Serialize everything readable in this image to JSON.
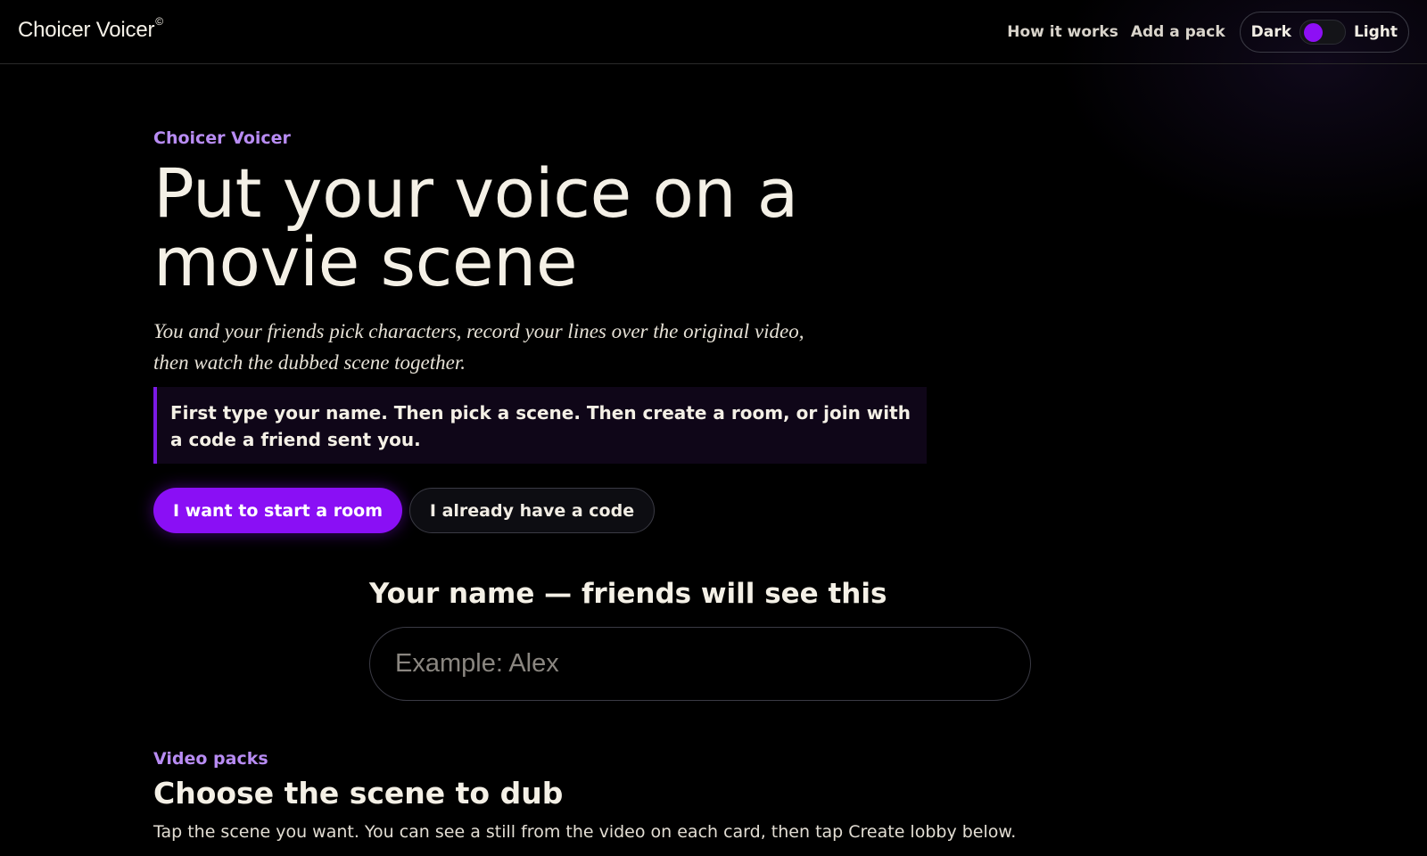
{
  "header": {
    "brand": "Choicer Voicer",
    "brand_mark": "©",
    "nav": {
      "how_it_works": "How it works",
      "add_pack": "Add a pack"
    },
    "theme": {
      "dark_label": "Dark",
      "light_label": "Light",
      "selected": "Dark"
    }
  },
  "hero": {
    "eyebrow": "Choicer Voicer",
    "title": "Put your voice on a movie scene",
    "subtitle": "You and your friends pick characters, record your lines over the original video, then watch the dubbed scene together.",
    "hint": "First type your name. Then pick a scene. Then create a room, or join with a code a friend sent you.",
    "primary_button": "I want to start a room",
    "secondary_button": "I already have a code"
  },
  "name_form": {
    "label": "Your name — friends will see this",
    "placeholder": "Example: Alex",
    "value": ""
  },
  "packs": {
    "eyebrow": "Video packs",
    "title": "Choose the scene to dub",
    "description": "Tap the scene you want. You can see a still from the video on each card, then tap Create lobby below."
  },
  "colors": {
    "accent": "#8a0ff5",
    "eyebrow": "#b88cf3",
    "background": "#000000"
  }
}
